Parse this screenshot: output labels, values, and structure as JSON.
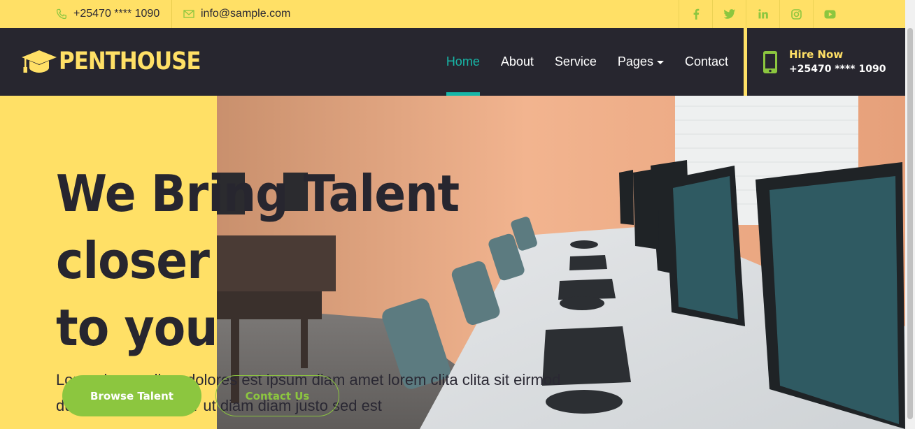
{
  "topbar": {
    "phone": "+25470 **** 1090",
    "email": "info@sample.com",
    "socials": [
      {
        "icon": "facebook-icon",
        "glyph": "f"
      },
      {
        "icon": "twitter-icon",
        "glyph": "t"
      },
      {
        "icon": "linkedin-icon",
        "glyph": "in"
      },
      {
        "icon": "instagram-icon",
        "glyph": "ig"
      },
      {
        "icon": "youtube-icon",
        "glyph": "yt"
      }
    ]
  },
  "navbar": {
    "brand": "PENTHOUSE",
    "items": [
      {
        "label": "Home",
        "active": true
      },
      {
        "label": "About"
      },
      {
        "label": "Service"
      },
      {
        "label": "Pages",
        "dropdown": true
      },
      {
        "label": "Contact"
      }
    ],
    "hire": {
      "title": "Hire Now",
      "phone": "+25470 **** 1090"
    }
  },
  "hero": {
    "title_line1": "We Bring Talent closer",
    "title_line2": "to you",
    "subtitle": "Lorem ipsum diam dolores est ipsum diam amet lorem clita clita sit eirmod duo clita dolore dolor ut diam diam justo sed est",
    "browse_button": "Browse Talent",
    "contact_button": "Contact Us"
  },
  "colors": {
    "yellow": "#ffe066",
    "dark": "#27262f",
    "green": "#8cc63f",
    "teal": "#17b7a8"
  }
}
